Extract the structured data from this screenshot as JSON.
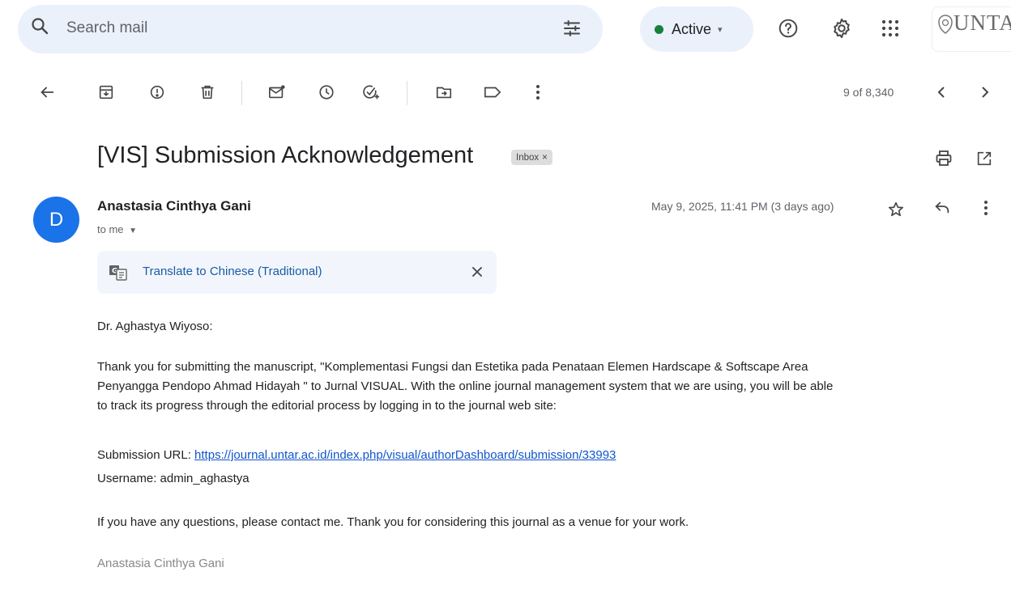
{
  "search": {
    "placeholder": "Search mail"
  },
  "status": {
    "label": "Active",
    "color": "#188038"
  },
  "header_icons": [
    "search-icon",
    "filter-icon",
    "help-icon",
    "gear-icon",
    "apps-icon"
  ],
  "org_logo": {
    "text": "UNTA"
  },
  "toolbar": {
    "icons": [
      "back-arrow-icon",
      "archive-icon",
      "report-spam-icon",
      "delete-icon",
      "mark-unread-icon",
      "snooze-icon",
      "add-task-icon",
      "move-to-icon",
      "label-icon",
      "more-vert-icon"
    ],
    "pager": "9 of 8,340"
  },
  "email": {
    "subject": "[VIS] Submission Acknowledgement",
    "label": "Inbox",
    "label_close": "×",
    "sender_initial": "D",
    "sender": "Anastasia Cinthya Gani",
    "recipient": "to me",
    "date": "May 9, 2025, 11:41 PM (3 days ago)",
    "translate_link": "Translate to Chinese (Traditional)",
    "greeting": "Dr. Aghastya Wiyoso:",
    "para1_line1": "Thank you for submitting the manuscript, \"Komplementasi Fungsi dan Estetika pada Penataan Elemen Hardscape & Softscape Area",
    "para1_line2": "Penyangga Pendopo Ahmad Hidayah \" to Jurnal VISUAL. With the online journal management system that we are using, you will be able",
    "para1_line3": "to track its progress through the editorial process by logging in to the journal web site:",
    "submission_label": "Submission URL: ",
    "submission_url": "https://journal.untar.ac.id/index.php/visual/authorDashboard/submission/33993",
    "username_line": "Username: admin_aghastya",
    "closing": "If you have any questions, please contact me. Thank you for considering this journal as a venue for your work.",
    "signature": "Anastasia Cinthya Gani"
  },
  "colors": {
    "avatar": "#1a73e8",
    "search_bg": "#eaf1fb",
    "link": "#1155cc"
  }
}
